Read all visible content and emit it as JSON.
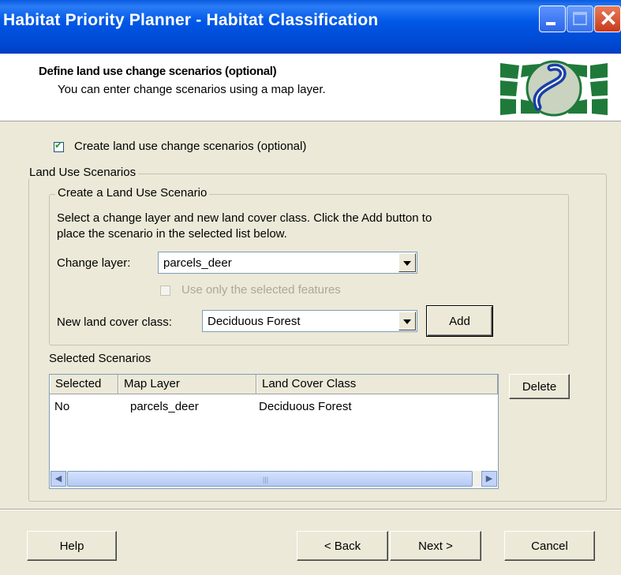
{
  "window": {
    "title": "Habitat Priority Planner - Habitat Classification"
  },
  "header": {
    "title": "Define land use change scenarios (optional)",
    "subtitle": "You can enter change scenarios using a map layer."
  },
  "enable_checkbox": {
    "label": "Create land use change scenarios (optional)",
    "checked": true
  },
  "land_use_group": {
    "title": "Land Use Scenarios",
    "create_group": {
      "title": "Create a Land Use Scenario",
      "instructions_line1": "Select a change layer and new land cover class.  Click the Add button to",
      "instructions_line2": "place the scenario in the selected list below.",
      "change_layer_label": "Change layer:",
      "change_layer_value": "parcels_deer",
      "selected_features_label": "Use only the selected features",
      "selected_features_checked": false,
      "land_cover_label": "New land cover class:",
      "land_cover_value": "Deciduous Forest",
      "add_button": "Add"
    },
    "selected_label": "Selected Scenarios",
    "table": {
      "columns": [
        "Selected",
        "Map Layer",
        "Land Cover Class"
      ],
      "rows": [
        [
          "No",
          "parcels_deer",
          "Deciduous Forest"
        ]
      ]
    },
    "delete_button": "Delete",
    "scroll_grip": "|||"
  },
  "footer": {
    "help": "Help",
    "back": "< Back",
    "next": "Next >",
    "cancel": "Cancel"
  }
}
